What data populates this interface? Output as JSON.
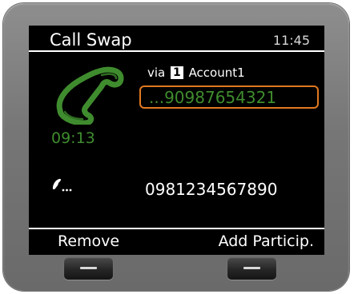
{
  "screen": {
    "title": "Call Swap",
    "clock": "11:45"
  },
  "active_call": {
    "via_label": "via",
    "account_number": "1",
    "account_name": "Account1",
    "number": "...90987654321",
    "duration": "09:13",
    "status_icon": "handset-active-icon",
    "accent_color": "#3f8c2e",
    "focus_color": "#e07820"
  },
  "held_call": {
    "status_icon": "handset-held-icon",
    "number": "0981234567890"
  },
  "softkeys": {
    "left_label": "Remove",
    "right_label": "Add Particip."
  },
  "hardware_buttons": {
    "left_icon": "softkey-bar-icon",
    "right_icon": "softkey-bar-icon"
  }
}
